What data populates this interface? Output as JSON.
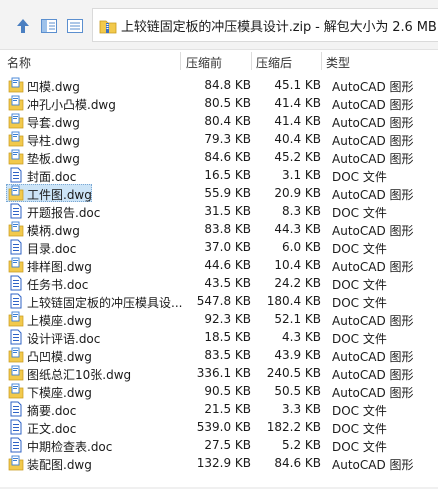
{
  "toolbar": {
    "path_text": "上较链固定板的冲压模具设计.zip - 解包大小为 2.6 MB"
  },
  "columns": {
    "name": "名称",
    "packed": "压缩前",
    "compressed": "压缩后",
    "type": "类型"
  },
  "files": [
    {
      "name": "凹模.dwg",
      "packed": "84.8 KB",
      "compressed": "45.1 KB",
      "type": "AutoCAD 图形",
      "icon": "dwg-icon"
    },
    {
      "name": "冲孔小凸模.dwg",
      "packed": "80.5 KB",
      "compressed": "41.4 KB",
      "type": "AutoCAD 图形",
      "icon": "dwg-icon"
    },
    {
      "name": "导套.dwg",
      "packed": "80.4 KB",
      "compressed": "41.4 KB",
      "type": "AutoCAD 图形",
      "icon": "dwg-icon"
    },
    {
      "name": "导柱.dwg",
      "packed": "79.3 KB",
      "compressed": "40.4 KB",
      "type": "AutoCAD 图形",
      "icon": "dwg-icon"
    },
    {
      "name": "垫板.dwg",
      "packed": "84.6 KB",
      "compressed": "45.2 KB",
      "type": "AutoCAD 图形",
      "icon": "dwg-icon"
    },
    {
      "name": "封面.doc",
      "packed": "16.5 KB",
      "compressed": "3.1 KB",
      "type": "DOC 文件",
      "icon": "doc-icon"
    },
    {
      "name": "工件图.dwg",
      "packed": "55.9 KB",
      "compressed": "20.9 KB",
      "type": "AutoCAD 图形",
      "icon": "dwg-icon"
    },
    {
      "name": "开题报告.doc",
      "packed": "31.5 KB",
      "compressed": "8.3 KB",
      "type": "DOC 文件",
      "icon": "doc-icon"
    },
    {
      "name": "模柄.dwg",
      "packed": "83.8 KB",
      "compressed": "44.3 KB",
      "type": "AutoCAD 图形",
      "icon": "dwg-icon"
    },
    {
      "name": "目录.doc",
      "packed": "37.0 KB",
      "compressed": "6.0 KB",
      "type": "DOC 文件",
      "icon": "doc-icon"
    },
    {
      "name": "排样图.dwg",
      "packed": "44.6 KB",
      "compressed": "10.4 KB",
      "type": "AutoCAD 图形",
      "icon": "dwg-icon"
    },
    {
      "name": "任务书.doc",
      "packed": "43.5 KB",
      "compressed": "24.2 KB",
      "type": "DOC 文件",
      "icon": "doc-icon"
    },
    {
      "name": "上较链固定板的冲压模具设...",
      "packed": "547.8 KB",
      "compressed": "180.4 KB",
      "type": "DOC 文件",
      "icon": "doc-icon"
    },
    {
      "name": "上模座.dwg",
      "packed": "92.3 KB",
      "compressed": "52.1 KB",
      "type": "AutoCAD 图形",
      "icon": "dwg-icon"
    },
    {
      "name": "设计评语.doc",
      "packed": "18.5 KB",
      "compressed": "4.3 KB",
      "type": "DOC 文件",
      "icon": "doc-icon"
    },
    {
      "name": "凸凹模.dwg",
      "packed": "83.5 KB",
      "compressed": "43.9 KB",
      "type": "AutoCAD 图形",
      "icon": "dwg-icon"
    },
    {
      "name": "图纸总汇10张.dwg",
      "packed": "336.1 KB",
      "compressed": "240.5 KB",
      "type": "AutoCAD 图形",
      "icon": "dwg-icon"
    },
    {
      "name": "下模座.dwg",
      "packed": "90.5 KB",
      "compressed": "50.5 KB",
      "type": "AutoCAD 图形",
      "icon": "dwg-icon"
    },
    {
      "name": "摘要.doc",
      "packed": "21.5 KB",
      "compressed": "3.3 KB",
      "type": "DOC 文件",
      "icon": "doc-icon"
    },
    {
      "name": "正文.doc",
      "packed": "539.0 KB",
      "compressed": "182.2 KB",
      "type": "DOC 文件",
      "icon": "doc-icon"
    },
    {
      "name": "中期检查表.doc",
      "packed": "27.5 KB",
      "compressed": "5.2 KB",
      "type": "DOC 文件",
      "icon": "doc-icon"
    },
    {
      "name": "装配图.dwg",
      "packed": "132.9 KB",
      "compressed": "84.6 KB",
      "type": "AutoCAD 图形",
      "icon": "dwg-icon"
    }
  ],
  "selected_index": 6,
  "colors": {
    "selection": "#cce4f7",
    "dwg_folder": "#f2c94c",
    "dwg_sheet": "#3b7fd4",
    "doc_blue": "#2f63c6"
  }
}
